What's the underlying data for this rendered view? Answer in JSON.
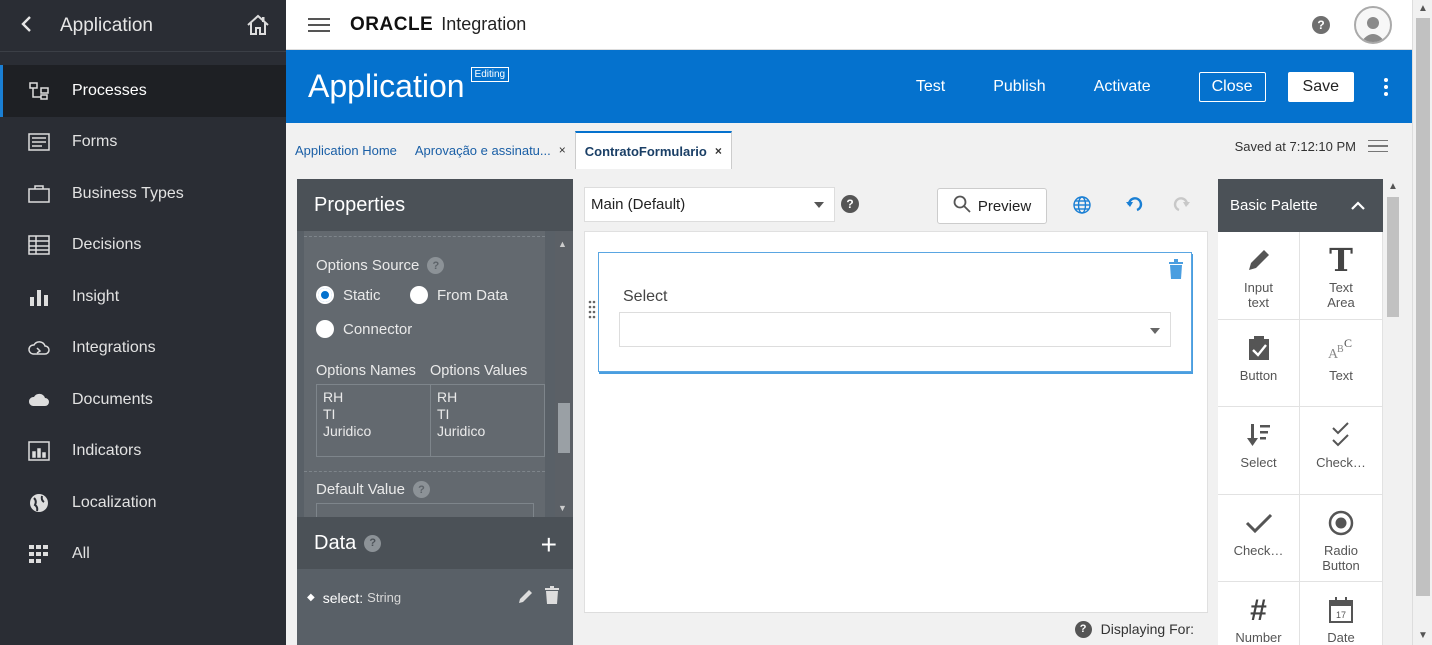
{
  "sidebar": {
    "title": "Application",
    "items": [
      {
        "label": "Processes",
        "icon": "processes-icon",
        "active": true
      },
      {
        "label": "Forms",
        "icon": "forms-icon"
      },
      {
        "label": "Business Types",
        "icon": "briefcase-icon"
      },
      {
        "label": "Decisions",
        "icon": "table-icon"
      },
      {
        "label": "Insight",
        "icon": "bar-chart-icon"
      },
      {
        "label": "Integrations",
        "icon": "cloud-sync-icon"
      },
      {
        "label": "Documents",
        "icon": "cloud-icon"
      },
      {
        "label": "Indicators",
        "icon": "indicator-icon"
      },
      {
        "label": "Localization",
        "icon": "globe-icon"
      },
      {
        "label": "All",
        "icon": "grid-icon"
      }
    ]
  },
  "topbar": {
    "brand": "ORACLE",
    "product": "Integration",
    "help": "?"
  },
  "appbar": {
    "title": "Application",
    "badge": "Editing",
    "test": "Test",
    "publish": "Publish",
    "activate": "Activate",
    "close": "Close",
    "save": "Save"
  },
  "tabs": {
    "items": [
      {
        "label": "Application Home"
      },
      {
        "label": "Aprovação e assinatu...",
        "closable": true
      },
      {
        "label": "ContratoFormulario",
        "closable": true,
        "active": true
      }
    ],
    "close_glyph": "×",
    "saved": "Saved at 7:12:10 PM"
  },
  "properties": {
    "title": "Properties",
    "options_source_label": "Options Source",
    "radio_static": "Static",
    "radio_from_data": "From Data",
    "radio_connector": "Connector",
    "col_names": "Options Names",
    "col_values": "Options Values",
    "names": "RH\nTI\nJuridico",
    "values": "RH\nTI\nJuridico",
    "default_value_label": "Default Value",
    "help": "?"
  },
  "data_panel": {
    "title": "Data",
    "help": "?",
    "add": "+",
    "item_name": "select:",
    "item_type": "String"
  },
  "canvas": {
    "layout_select": "Main (Default)",
    "preview": "Preview",
    "field_label": "Select",
    "displaying_for": "Displaying For:",
    "help": "?"
  },
  "palette": {
    "title": "Basic Palette",
    "items": [
      {
        "label": "Input\ntext",
        "icon": "pencil-icon"
      },
      {
        "label": "Text\nArea",
        "icon": "text-area-icon"
      },
      {
        "label": "Button",
        "icon": "button-icon"
      },
      {
        "label": "Text",
        "icon": "text-icon"
      },
      {
        "label": "Select",
        "icon": "select-icon"
      },
      {
        "label": "Check…",
        "icon": "checklist-icon"
      },
      {
        "label": "Check…",
        "icon": "checkmark-icon"
      },
      {
        "label": "Radio\nButton",
        "icon": "radio-icon"
      },
      {
        "label": "Number",
        "icon": "hash-icon"
      },
      {
        "label": "Date",
        "icon": "calendar-icon"
      }
    ]
  },
  "colors": {
    "brand_blue": "#0572ce",
    "sidebar_bg": "#2a2d34",
    "panel_bg": "#596067"
  }
}
